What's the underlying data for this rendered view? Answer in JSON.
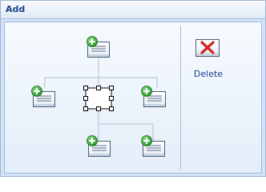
{
  "window": {
    "title": "Add"
  },
  "toolbar": {
    "delete_label": "Delete"
  },
  "icons": {
    "add": "plus-circle-icon",
    "node": "document-icon",
    "delete": "red-x-icon"
  },
  "colors": {
    "title_text": "#15428b",
    "panel_border": "#99bbe8",
    "connector": "#aebfd3",
    "plus_green": "#2e9e2e",
    "delete_red": "#d21f1f"
  }
}
